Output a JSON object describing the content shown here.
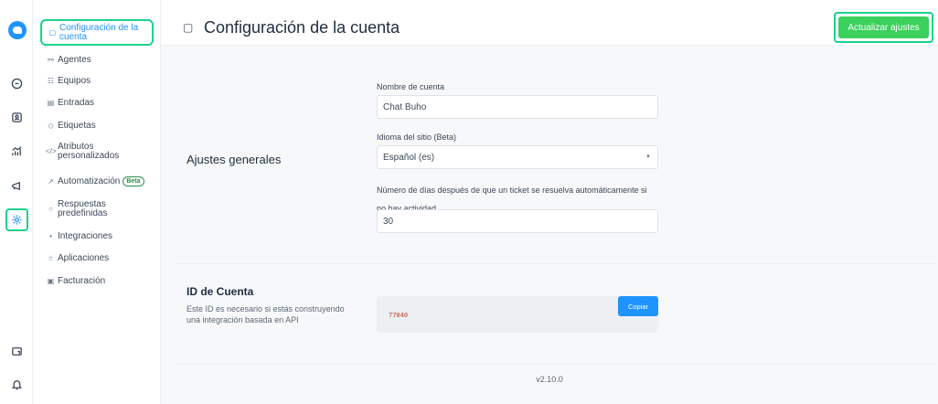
{
  "rail": {
    "icons": [
      "logo",
      "conversations-icon",
      "contacts-icon",
      "reports-icon",
      "campaigns-icon",
      "settings-icon",
      "help-center-icon",
      "notifications-icon"
    ]
  },
  "sidebar": {
    "items": [
      {
        "label": "Configuración de la cuenta",
        "icon": "cube-icon",
        "active": true
      },
      {
        "label": "Agentes",
        "icon": "agents-icon"
      },
      {
        "label": "Equipos",
        "icon": "teams-icon"
      },
      {
        "label": "Entradas",
        "icon": "inboxes-icon"
      },
      {
        "label": "Etiquetas",
        "icon": "tag-icon"
      },
      {
        "label": "Atributos personalizados",
        "icon": "code-icon"
      },
      {
        "label": "Automatización",
        "icon": "automation-icon",
        "badge": "Beta"
      },
      {
        "label": "Respuestas predefinidas",
        "icon": "chat-bubble-icon"
      },
      {
        "label": "Integraciones",
        "icon": "plug-icon"
      },
      {
        "label": "Aplicaciones",
        "icon": "apps-icon"
      },
      {
        "label": "Facturación",
        "icon": "billing-icon"
      }
    ]
  },
  "header": {
    "title": "Configuración de la cuenta",
    "update_button": "Actualizar ajustes"
  },
  "general": {
    "title": "Ajustes generales",
    "account_name_label": "Nombre de cuenta",
    "account_name_value": "Chat Buho",
    "language_label": "Idioma del sitio (Beta)",
    "language_value": "Español (es)",
    "auto_resolve_label": "Número de días después de que un ticket se resuelva automáticamente si no hay actividad",
    "auto_resolve_value": "30"
  },
  "account": {
    "title": "ID de Cuenta",
    "description": "Este ID es necesario si estás construyendo una integración basada en API",
    "id_value": "77040",
    "copy_button": "Copiar"
  },
  "footer": {
    "version": "v2.10.0"
  },
  "colors": {
    "accent": "#1f93ff",
    "success": "#3bd15c",
    "highlight": "#1bd38a"
  }
}
